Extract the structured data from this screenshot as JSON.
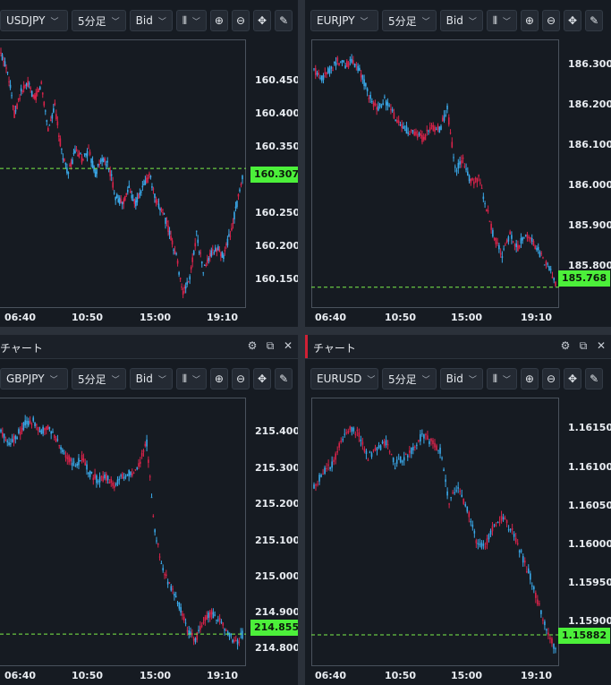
{
  "common": {
    "timeframe": "5分足",
    "price_type": "Bid",
    "window_title": "チャート"
  },
  "charts": [
    {
      "symbol": "USDJPY",
      "last_price": "160.307",
      "y_ticks": [
        "160.450",
        "160.400",
        "160.350",
        "160.300",
        "160.250",
        "160.200",
        "160.150"
      ],
      "x_ticks": [
        "06:40",
        "10:50",
        "15:00",
        "19:10"
      ],
      "chart_data": {
        "type": "line",
        "ylim": [
          160.12,
          160.48
        ],
        "last": 160.307,
        "path": [
          160.46,
          160.44,
          160.38,
          160.41,
          160.42,
          160.4,
          160.42,
          160.36,
          160.39,
          160.33,
          160.3,
          160.33,
          160.32,
          160.33,
          160.3,
          160.32,
          160.31,
          160.27,
          160.26,
          160.28,
          160.26,
          160.28,
          160.3,
          160.26,
          160.25,
          160.22,
          160.19,
          160.14,
          160.16,
          160.22,
          160.17,
          160.19,
          160.2,
          160.19,
          160.22,
          160.26,
          160.3
        ]
      }
    },
    {
      "symbol": "EURJPY",
      "last_price": "185.768",
      "y_ticks": [
        "186.300",
        "186.200",
        "186.100",
        "186.000",
        "185.900",
        "185.800"
      ],
      "x_ticks": [
        "06:40",
        "10:50",
        "15:00",
        "19:10"
      ],
      "chart_data": {
        "type": "line",
        "ylim": [
          185.72,
          186.34
        ],
        "last": 185.768,
        "path": [
          186.27,
          186.25,
          186.27,
          186.29,
          186.28,
          186.29,
          186.26,
          186.21,
          186.18,
          186.2,
          186.17,
          186.14,
          186.13,
          186.12,
          186.11,
          186.14,
          186.13,
          186.18,
          186.04,
          186.06,
          186.01,
          186.02,
          185.95,
          185.88,
          185.84,
          185.89,
          185.86,
          185.89,
          185.87,
          185.84,
          185.81,
          185.77
        ]
      }
    },
    {
      "symbol": "GBPJPY",
      "last_price": "214.855",
      "y_ticks": [
        "215.400",
        "215.300",
        "215.200",
        "215.100",
        "215.000",
        "214.900",
        "214.800"
      ],
      "x_ticks": [
        "06:40",
        "10:50",
        "15:00",
        "19:10"
      ],
      "chart_data": {
        "type": "line",
        "ylim": [
          214.77,
          215.48
        ],
        "last": 214.855,
        "path": [
          215.39,
          215.36,
          215.38,
          215.41,
          215.42,
          215.39,
          215.4,
          215.36,
          215.33,
          215.3,
          215.32,
          215.28,
          215.26,
          215.27,
          215.25,
          215.27,
          215.28,
          215.3,
          215.36,
          215.13,
          215.02,
          214.98,
          214.93,
          214.87,
          214.84,
          214.89,
          214.91,
          214.89,
          214.86,
          214.83,
          214.86
        ]
      }
    },
    {
      "symbol": "EURUSD",
      "last_price": "1.15882",
      "y_ticks": [
        "1.16150",
        "1.16100",
        "1.16050",
        "1.16000",
        "1.15950",
        "1.15900"
      ],
      "x_ticks": [
        "06:40",
        "10:50",
        "15:00",
        "19:10"
      ],
      "chart_data": {
        "type": "line",
        "ylim": [
          1.1584,
          1.162
        ],
        "last": 1.15882,
        "path": [
          1.1608,
          1.161,
          1.1611,
          1.1614,
          1.1616,
          1.1615,
          1.1612,
          1.1613,
          1.1614,
          1.1611,
          1.1612,
          1.1613,
          1.1615,
          1.1614,
          1.1613,
          1.1606,
          1.1608,
          1.1605,
          1.1601,
          1.16,
          1.1603,
          1.1604,
          1.1602,
          1.1599,
          1.1596,
          1.1592,
          1.1588,
          1.1586
        ]
      }
    }
  ]
}
